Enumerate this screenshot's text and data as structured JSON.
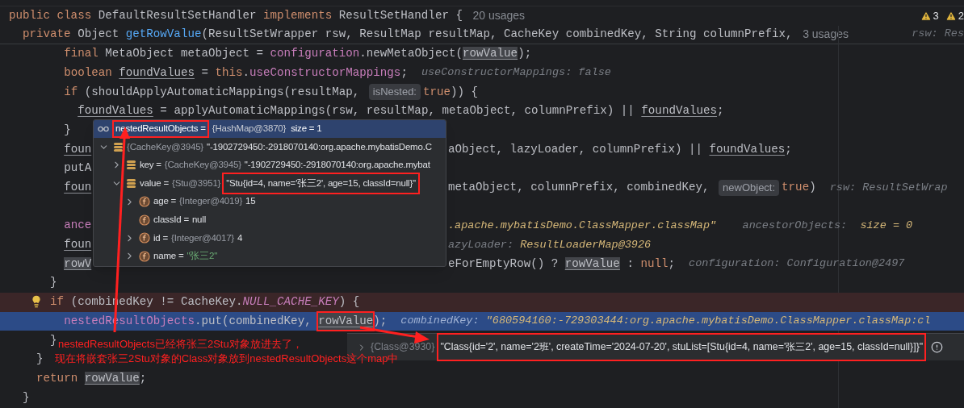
{
  "sticky_header": [
    {
      "segments": [
        {
          "kind": "keyword",
          "text": "public class "
        },
        {
          "kind": "plain",
          "text": "DefaultResultSetHandler "
        },
        {
          "kind": "keyword",
          "text": "implements "
        },
        {
          "kind": "plain",
          "text": "ResultSetHandler { "
        },
        {
          "kind": "usages",
          "text": "20 usages"
        }
      ],
      "warnings": [
        {
          "count": "3"
        },
        {
          "count": "2"
        }
      ]
    },
    {
      "segments": [
        {
          "kind": "keyword",
          "text": "  private "
        },
        {
          "kind": "plain",
          "text": "Object "
        },
        {
          "kind": "method",
          "text": "getRowValue"
        },
        {
          "kind": "plain",
          "text": "(ResultSetWrapper rsw, ResultMap resultMap, CacheKey combinedKey, String columnPrefix, "
        },
        {
          "kind": "usages",
          "text": "3 usages"
        },
        {
          "kind": "hint_right",
          "text": "rsw: Res"
        }
      ]
    }
  ],
  "lines": [
    {
      "kind": "normal",
      "segments": [
        {
          "kind": "keyword",
          "text": "        final "
        },
        {
          "kind": "plain",
          "text": "MetaObject metaObject = "
        },
        {
          "kind": "field",
          "text": "configuration"
        },
        {
          "kind": "plain",
          "text": ".newMetaObject("
        },
        {
          "kind": "var_hl",
          "text": "rowValue"
        },
        {
          "kind": "plain",
          "text": ");"
        }
      ]
    },
    {
      "kind": "normal",
      "segments": [
        {
          "kind": "keyword",
          "text": "        boolean "
        },
        {
          "kind": "var",
          "text": "foundValues"
        },
        {
          "kind": "plain",
          "text": " = "
        },
        {
          "kind": "keyword",
          "text": "this"
        },
        {
          "kind": "plain",
          "text": "."
        },
        {
          "kind": "field",
          "text": "useConstructorMappings"
        },
        {
          "kind": "plain",
          "text": ";  "
        },
        {
          "kind": "hint",
          "text": "useConstructorMappings: false"
        }
      ]
    },
    {
      "kind": "normal",
      "segments": [
        {
          "kind": "keyword",
          "text": "        if "
        },
        {
          "kind": "plain",
          "text": "(shouldApplyAutomaticMappings(resultMap, "
        },
        {
          "kind": "chip",
          "text": "isNested:"
        },
        {
          "kind": "keyword",
          "text": "true"
        },
        {
          "kind": "plain",
          "text": ")) {"
        }
      ]
    },
    {
      "kind": "normal",
      "segments": [
        {
          "kind": "var",
          "text": "          foundValues"
        },
        {
          "kind": "plain",
          "text": " = applyAutomaticMappings(rsw, resultMap, metaObject, columnPrefix) || "
        },
        {
          "kind": "var",
          "text": "foundValues"
        },
        {
          "kind": "plain",
          "text": ";"
        }
      ]
    },
    {
      "kind": "normal",
      "segments": [
        {
          "kind": "plain",
          "text": "        }"
        }
      ]
    },
    {
      "kind": "normal",
      "segments": [
        {
          "kind": "var",
          "text": "        foun"
        }
      ],
      "right": [
        {
          "kind": "plain",
          "text": "aObject, lazyLoader, columnPrefix) || "
        },
        {
          "kind": "var",
          "text": "foundValues"
        },
        {
          "kind": "plain",
          "text": ";"
        }
      ]
    },
    {
      "kind": "normal",
      "segments": [
        {
          "kind": "plain",
          "text": "        putA"
        }
      ]
    },
    {
      "kind": "normal",
      "segments": [
        {
          "kind": "var",
          "text": "        foun"
        }
      ],
      "right": [
        {
          "kind": "plain",
          "text": "metaObject, columnPrefix, combinedKey, "
        },
        {
          "kind": "chip",
          "text": "newObject:"
        },
        {
          "kind": "keyword",
          "text": "true"
        },
        {
          "kind": "plain",
          "text": ")  "
        },
        {
          "kind": "hint",
          "text": "rsw: ResultSetWrap"
        }
      ]
    },
    {
      "kind": "blank"
    },
    {
      "kind": "normal",
      "segments": [
        {
          "kind": "field",
          "text": "        ance"
        }
      ],
      "right": [
        {
          "kind": "hint_value",
          "text": ".apache.mybatisDemo.ClassMapper.classMap\""
        },
        {
          "kind": "hint",
          "text": "    ancestorObjects:  "
        },
        {
          "kind": "hint_value",
          "text": "size = 0"
        }
      ]
    },
    {
      "kind": "normal",
      "segments": [
        {
          "kind": "var",
          "text": "        foun"
        }
      ],
      "right": [
        {
          "kind": "hint",
          "text": "azyLoader: "
        },
        {
          "kind": "hint_value",
          "text": "ResultLoaderMap@3926"
        }
      ]
    },
    {
      "kind": "normal",
      "segments": [
        {
          "kind": "var_hl",
          "text": "        rowV"
        }
      ],
      "right": [
        {
          "kind": "plain",
          "text": "eForEmptyRow() ? "
        },
        {
          "kind": "var_hl",
          "text": "rowValue"
        },
        {
          "kind": "plain",
          "text": " : "
        },
        {
          "kind": "keyword",
          "text": "null"
        },
        {
          "kind": "plain",
          "text": ";  "
        },
        {
          "kind": "hint",
          "text": "configuration: Configuration@2497"
        }
      ]
    },
    {
      "kind": "normal",
      "segments": [
        {
          "kind": "plain",
          "text": "      }"
        }
      ]
    },
    {
      "kind": "breakpoint",
      "segments": [
        {
          "kind": "keyword",
          "text": "      if "
        },
        {
          "kind": "plain",
          "text": "(combinedKey != CacheKey."
        },
        {
          "kind": "static",
          "text": "NULL_CACHE_KEY"
        },
        {
          "kind": "plain",
          "text": ") {"
        }
      ]
    },
    {
      "kind": "current",
      "segments": [
        {
          "kind": "field",
          "text": "        nestedResultObjects"
        },
        {
          "kind": "plain",
          "text": ".put(combinedKey, "
        },
        {
          "kind": "var_hl",
          "text": "rowValue",
          "boxed": true
        },
        {
          "kind": "plain",
          "text": ");  "
        },
        {
          "kind": "hint",
          "text": "combinedKey: "
        },
        {
          "kind": "hint_value",
          "text": "\"680594160:-729303444:org.apache.mybatisDemo.ClassMapper.classMap:cl"
        }
      ]
    },
    {
      "kind": "normal",
      "segments": [
        {
          "kind": "plain",
          "text": "      }"
        }
      ]
    },
    {
      "kind": "normal",
      "segments": [
        {
          "kind": "plain",
          "text": "    }"
        }
      ]
    },
    {
      "kind": "normal",
      "segments": [
        {
          "kind": "keyword",
          "text": "    return "
        },
        {
          "kind": "var_hl",
          "text": "rowValue"
        },
        {
          "kind": "plain",
          "text": ";"
        }
      ]
    },
    {
      "kind": "normal",
      "segments": [
        {
          "kind": "plain",
          "text": "  }"
        }
      ]
    }
  ],
  "debug_popup": {
    "header": {
      "name": "nestedResultObjects =",
      "type": "{HashMap@3870}",
      "value": "size = 1",
      "selected": true,
      "boxed": true
    },
    "nodes": [
      {
        "kind": "entry",
        "expandable": true,
        "expanded": true,
        "type": "{CacheKey@3945}",
        "value": "\"-1902729450:-2918070140:org.apache.mybatisDemo.C",
        "children": [
          {
            "kind": "entry",
            "expandable": true,
            "expanded": false,
            "name": "key =",
            "type": "{CacheKey@3945}",
            "value": "\"-1902729450:-2918070140:org.apache.mybat"
          },
          {
            "kind": "entry",
            "expandable": true,
            "expanded": true,
            "name": "value =",
            "type": "{Stu@3951}",
            "value": "\"Stu{id=4, name='张三2', age=15, classId=null}\"",
            "boxed": true,
            "children": [
              {
                "kind": "field",
                "expandable": true,
                "expanded": false,
                "name": "age =",
                "type": "{Integer@4019}",
                "value": "15"
              },
              {
                "kind": "field",
                "expandable": false,
                "name": "classId =",
                "value": "null"
              },
              {
                "kind": "field",
                "expandable": true,
                "expanded": false,
                "name": "id =",
                "type": "{Integer@4017}",
                "value": "4"
              },
              {
                "kind": "string_field",
                "expandable": true,
                "expanded": false,
                "name": "name =",
                "value": "\"张三2\""
              }
            ]
          }
        ]
      }
    ]
  },
  "value_tooltip": {
    "expanded": false,
    "type": "{Class@3930}",
    "value": "\"Class{id='2', name='2班', createTime='2024-07-20', stuList=[Stu{id=4, name='张三2', age=15, classId=null}]}\"",
    "boxed": true
  },
  "annotation": {
    "lines": [
      "nestedResultObjects已经将张三2Stu对象放进去了，",
      "现在将嵌套张三2Stu对象的Class对象放到nestedResultObjects这个map中"
    ]
  }
}
